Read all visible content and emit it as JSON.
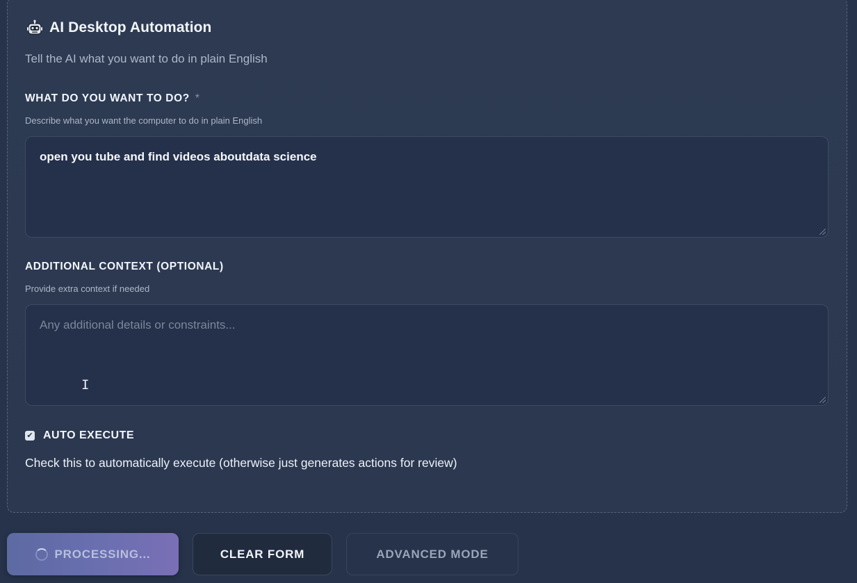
{
  "header": {
    "title": "AI Desktop Automation",
    "subtitle": "Tell the AI what you want to do in plain English",
    "icon": "robot-icon"
  },
  "task_field": {
    "label": "WHAT DO YOU WANT TO DO?",
    "required_mark": "*",
    "help": "Describe what you want the computer to do in plain English",
    "value": "open you tube and find  videos aboutdata science"
  },
  "context_field": {
    "label": "ADDITIONAL CONTEXT (OPTIONAL)",
    "help": "Provide extra context if needed",
    "value": "",
    "placeholder": "Any additional details or constraints..."
  },
  "auto_execute": {
    "label": "AUTO EXECUTE",
    "checked": true,
    "check_glyph": "✔",
    "help": "Check this to automatically execute (otherwise just generates actions for review)"
  },
  "buttons": {
    "processing_label": "PROCESSING...",
    "clear_label": "CLEAR FORM",
    "advanced_label": "ADVANCED MODE"
  },
  "colors": {
    "background": "#27334a",
    "panel": "#2d3a52",
    "accent": "#6a6fb0"
  }
}
